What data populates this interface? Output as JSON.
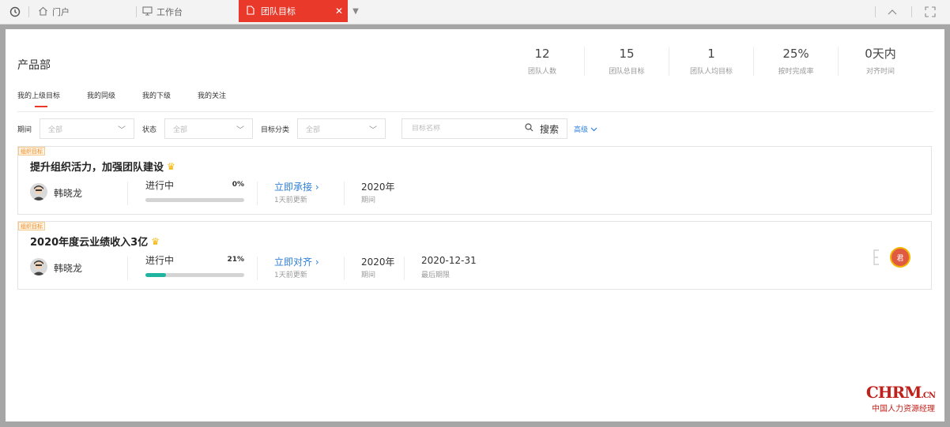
{
  "tabbar": {
    "portal_label": "门户",
    "workbench_label": "工作台",
    "active_tab_label": "团队目标"
  },
  "header": {
    "department": "产品部",
    "stats": [
      {
        "value": "12",
        "label": "团队人数"
      },
      {
        "value": "15",
        "label": "团队总目标"
      },
      {
        "value": "1",
        "label": "团队人均目标"
      },
      {
        "value": "25%",
        "label": "按时完成率"
      },
      {
        "value": "0天内",
        "label": "对齐时间"
      }
    ]
  },
  "subtabs": [
    "我的上级目标",
    "我的同级",
    "我的下级",
    "我的关注"
  ],
  "filters": {
    "period_label": "期间",
    "period_value": "全部",
    "status_label": "状态",
    "status_value": "全部",
    "category_label": "目标分类",
    "category_value": "全部",
    "search_placeholder": "目标名称",
    "search_button": "搜索",
    "advanced": "高级"
  },
  "goals": [
    {
      "tag": "组织目标",
      "title": "提升组织活力，加强团队建设",
      "owner": "韩晓龙",
      "status": "进行中",
      "progress": "0%",
      "progress_value": 0,
      "action": "立即承接 ›",
      "updated": "1天前更新",
      "period": "2020年",
      "period_label": "期间"
    },
    {
      "tag": "组织目标",
      "title": "2020年度云业绩收入3亿",
      "owner": "韩晓龙",
      "status": "进行中",
      "progress": "21%",
      "progress_value": 21,
      "action": "立即对齐 ›",
      "updated": "1天前更新",
      "period": "2020年",
      "period_label": "期间",
      "deadline": "2020-12-31",
      "deadline_label": "最后期限",
      "aligned_avatar": "君"
    }
  ],
  "watermark": {
    "brand": "CHRM",
    "suffix": ".CN",
    "tagline": "中国人力资源经理"
  },
  "colors": {
    "accent": "#e8392b",
    "link": "#2e7fd8",
    "progress": "#1eb4a0",
    "tag": "#f08a24"
  }
}
